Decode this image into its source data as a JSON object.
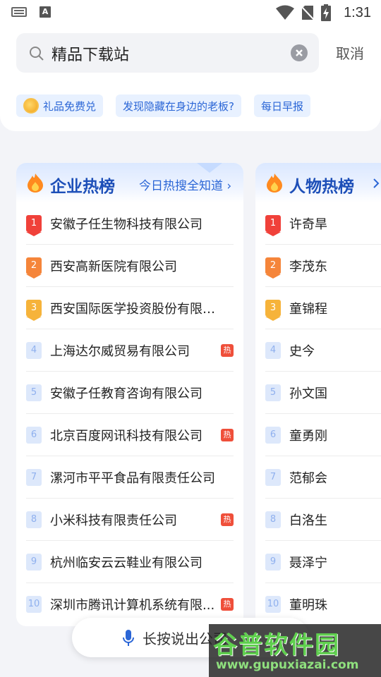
{
  "status_bar": {
    "time": "1:31",
    "input_icon": "A"
  },
  "search": {
    "value": "精品下载站",
    "cancel": "取消"
  },
  "chips": [
    "礼品免费兑",
    "发现隐藏在身边的老板?",
    "每日早报"
  ],
  "enterprise": {
    "title": "企业热榜",
    "subtitle": "今日热搜全知道",
    "items": [
      {
        "rank": "1",
        "name": "安徽子任生物科技有限公司",
        "hot": ""
      },
      {
        "rank": "2",
        "name": "西安高新医院有限公司",
        "hot": ""
      },
      {
        "rank": "3",
        "name": "西安国际医学投资股份有限公司",
        "hot": ""
      },
      {
        "rank": "4",
        "name": "上海达尔威贸易有限公司",
        "hot": "热"
      },
      {
        "rank": "5",
        "name": "安徽子任教育咨询有限公司",
        "hot": ""
      },
      {
        "rank": "6",
        "name": "北京百度网讯科技有限公司",
        "hot": "热"
      },
      {
        "rank": "7",
        "name": "漯河市平平食品有限责任公司",
        "hot": ""
      },
      {
        "rank": "8",
        "name": "小米科技有限责任公司",
        "hot": "热"
      },
      {
        "rank": "9",
        "name": "杭州临安云云鞋业有限公司",
        "hot": ""
      },
      {
        "rank": "10",
        "name": "深圳市腾讯计算机系统有限...",
        "hot": "热"
      }
    ]
  },
  "people": {
    "title": "人物热榜",
    "items": [
      {
        "rank": "1",
        "name": "许奇旱"
      },
      {
        "rank": "2",
        "name": "李茂东"
      },
      {
        "rank": "3",
        "name": "童锦程"
      },
      {
        "rank": "4",
        "name": "史今"
      },
      {
        "rank": "5",
        "name": "孙文国"
      },
      {
        "rank": "6",
        "name": "童勇刚"
      },
      {
        "rank": "7",
        "name": "范郁会"
      },
      {
        "rank": "8",
        "name": "白洛生"
      },
      {
        "rank": "9",
        "name": "聂泽宁"
      },
      {
        "rank": "10",
        "name": "董明珠"
      }
    ]
  },
  "voice": {
    "label": "长按说出公司"
  },
  "watermark": {
    "brand": "谷普软件园",
    "url": "www.gupuxiazai.com"
  },
  "colors": {
    "accent": "#2b66d6",
    "rank1": "#f0413a",
    "rank2": "#f5853a",
    "rank3": "#f6b33a",
    "hot": "#ef4f3a"
  }
}
